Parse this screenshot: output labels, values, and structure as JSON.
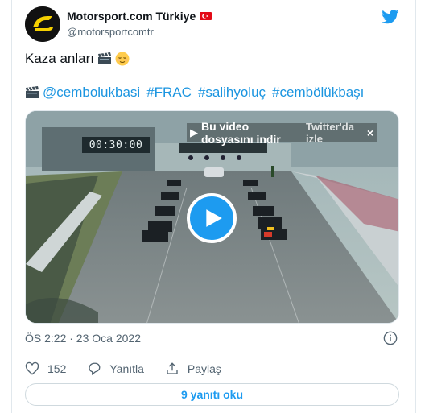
{
  "account": {
    "display_name": "Motorsport.com Türkiye",
    "handle": "@motorsportcomtr"
  },
  "tweet": {
    "line1": "Kaza anları",
    "hashtags": [
      "@cembolukbasi",
      "#FRAC",
      "#salihyoluç",
      "#cembölükbaşı"
    ]
  },
  "video": {
    "timer": "00:30:00",
    "download_text": "Bu video dosyasını indir",
    "twitter_text": "Twitter'da izle",
    "close": "×"
  },
  "meta": {
    "timestamp": "ÖS 2:22 · 23 Oca 2022"
  },
  "actions": {
    "likes": "152",
    "reply_label": "Yanıtla",
    "share_label": "Paylaş"
  },
  "replies": {
    "button_label": "9 yanıtı oku"
  },
  "colors": {
    "accent": "#1d9bf0",
    "text": "#0f1419",
    "muted": "#536471",
    "flag": "#e30a17"
  },
  "icons": [
    "twitter-bird-icon",
    "clapperboard-icon",
    "relieved-face-icon",
    "play-icon",
    "info-icon",
    "heart-icon",
    "reply-icon",
    "share-icon"
  ]
}
